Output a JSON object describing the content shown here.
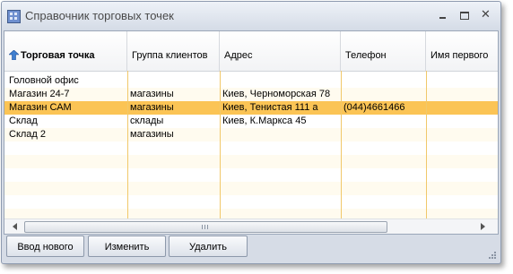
{
  "window": {
    "title": "Справочник торговых точек"
  },
  "title_buttons": {
    "minimize": "minimize-icon",
    "maximize": "maximize-icon",
    "close": "close-icon"
  },
  "grid": {
    "sorted_column_icon": "sort-ascending-icon",
    "columns": [
      "Торговая точка",
      "Группа клиентов",
      "Адрес",
      "Телефон",
      "Имя первого"
    ],
    "rows": [
      [
        "Головной офис",
        "",
        "",
        "",
        ""
      ],
      [
        "Магазин 24-7",
        "магазины",
        "Киев, Черноморская 78",
        "",
        ""
      ],
      [
        "Магазин САМ",
        "магазины",
        "Киев, Тенистая 111 а",
        "(044)4661466",
        ""
      ],
      [
        "Склад",
        "склады",
        "Киев, К.Маркса 45",
        "",
        ""
      ],
      [
        "Склад 2",
        "магазины",
        "",
        "",
        ""
      ]
    ],
    "selected_row": 2,
    "colors": {
      "selected_row": "#fbc455",
      "alt_row": "#fffbef",
      "column_line": "#f1c86a"
    }
  },
  "buttons": {
    "new": "Ввод нового",
    "edit": "Изменить",
    "delete": "Удалить"
  }
}
